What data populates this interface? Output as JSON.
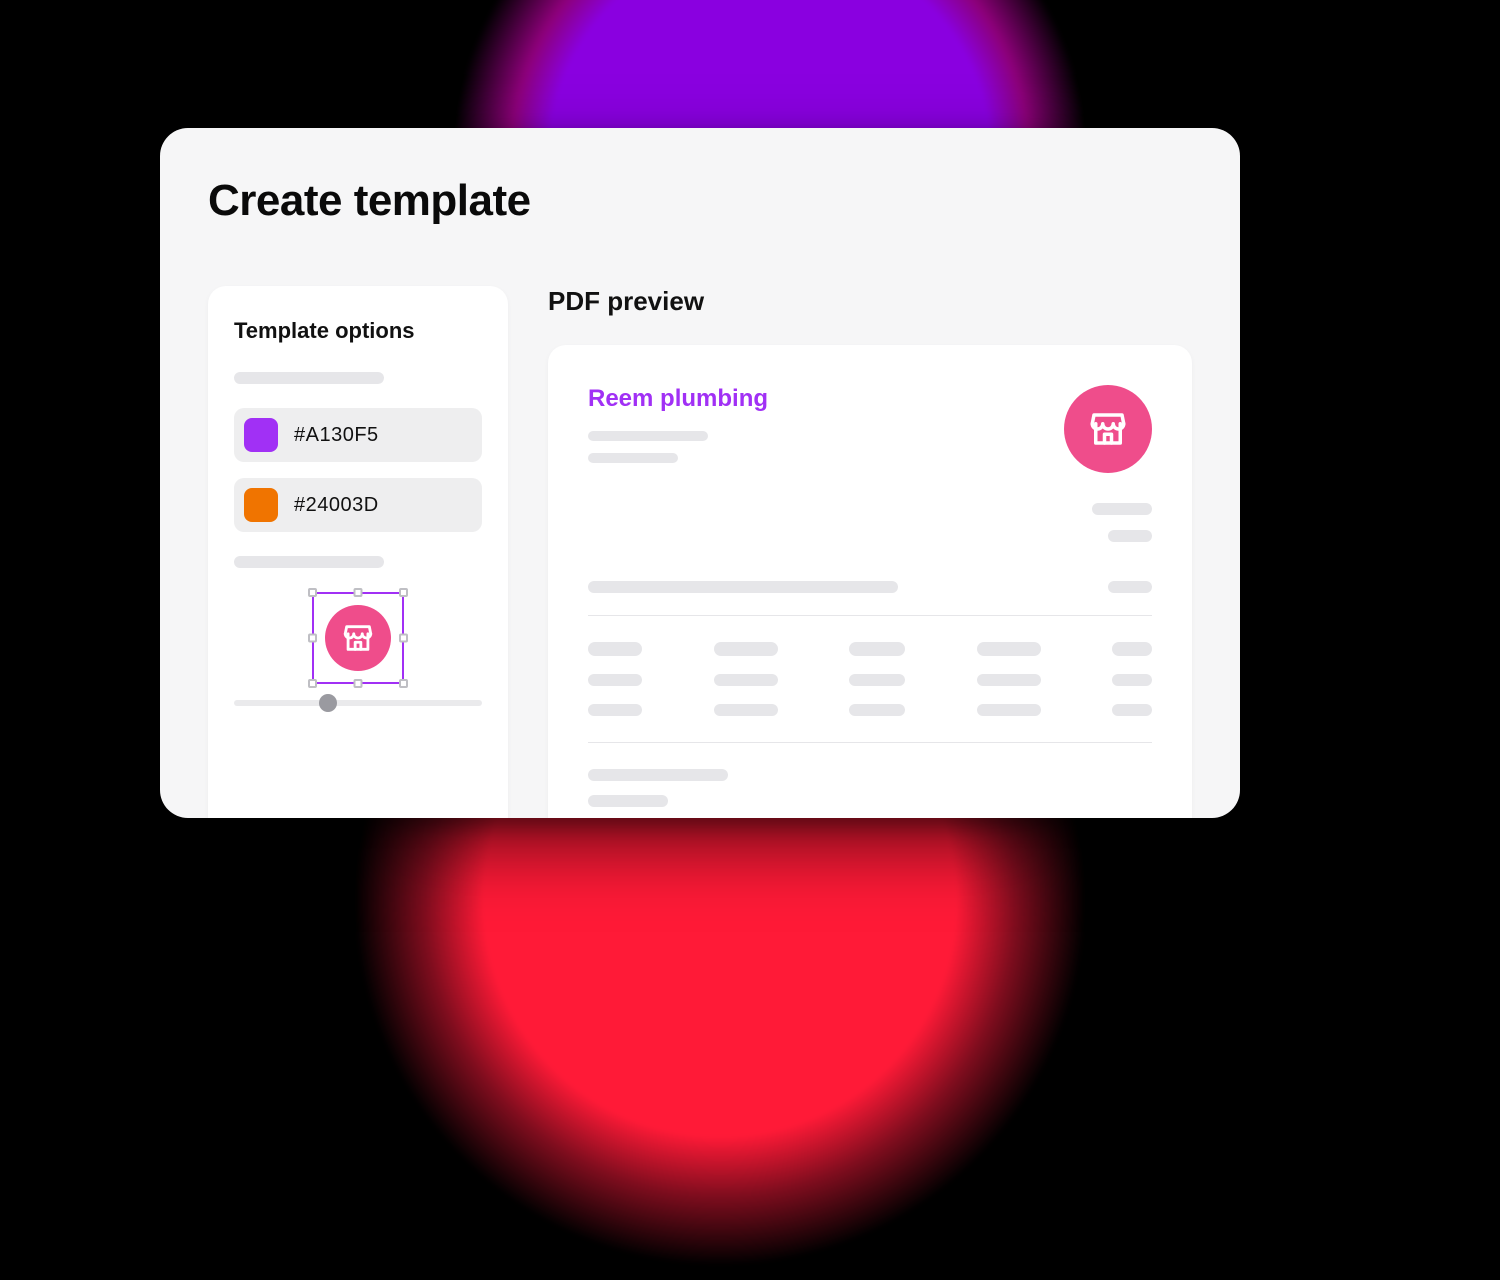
{
  "page": {
    "title": "Create template"
  },
  "sidebar": {
    "heading": "Template options",
    "colors": [
      {
        "hex": "#A130F5",
        "swatch": "#A130F5"
      },
      {
        "hex": "#24003D",
        "swatch": "#F07400"
      }
    ],
    "logo_icon": "store-icon",
    "logo_color": "#EF4D8B"
  },
  "preview": {
    "heading": "PDF preview",
    "company_name": "Reem plumbing",
    "accent_color": "#A130F5",
    "logo_icon": "store-icon",
    "logo_color": "#EF4D8B"
  }
}
